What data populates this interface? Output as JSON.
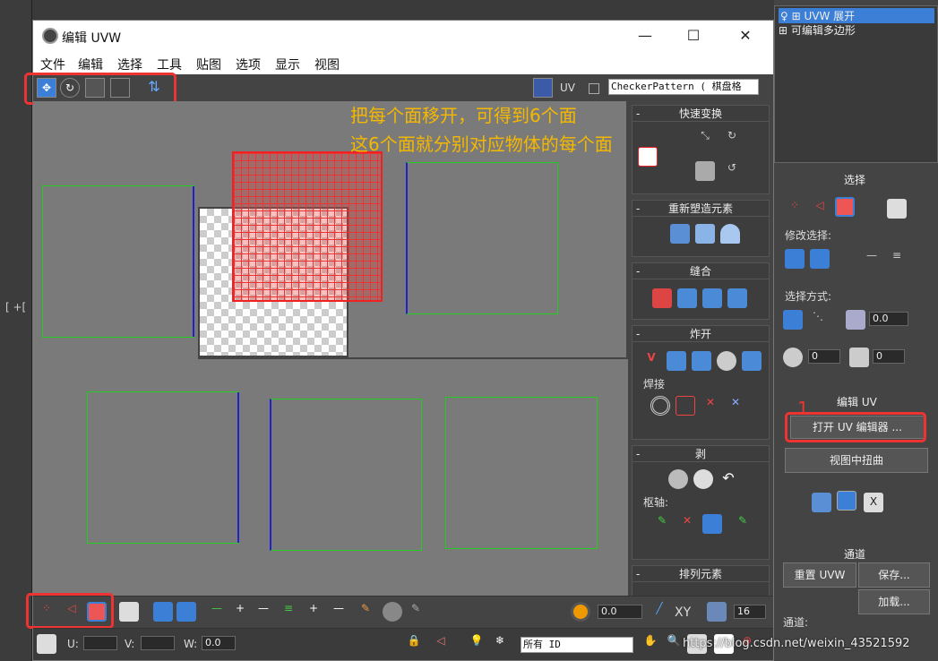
{
  "window": {
    "title": "编辑 UVW",
    "min": "—",
    "max": "☐",
    "close": "✕"
  },
  "menu": [
    "文件",
    "编辑",
    "选择",
    "工具",
    "贴图",
    "选项",
    "显示",
    "视图"
  ],
  "toolbar": {
    "uv_label": "UV",
    "texture_select": "CheckerPattern  ( 棋盘格"
  },
  "annotation": {
    "line1": "把每个面移开，可得到6个面",
    "line2": "这6个面就分别对应物体的每个面"
  },
  "right_panel": {
    "quick_transform": "快速变换",
    "reshape": "重新塑造元素",
    "stitch": "缝合",
    "explode": "炸开",
    "weld": "焊接",
    "peel": "剥",
    "pivot": "枢轴:",
    "arrange": "排列元素"
  },
  "bottom": {
    "spin_value": "0.0",
    "xy": "XY",
    "zoom_value": "16"
  },
  "status": {
    "u": "U:",
    "v": "V:",
    "w": "W:",
    "w_value": "0.0",
    "id_select": "所有 ID"
  },
  "modifier_stack": {
    "item1": "UVW 展开",
    "item2": "可编辑多边形"
  },
  "cmd": {
    "selection": "选择",
    "modify_selection": "修改选择:",
    "select_by": "选择方式:",
    "angle_value": "0.0",
    "num1": "0",
    "num2": "0",
    "edit_uv": "编辑 UV",
    "open_uv_editor": "打开 UV 编辑器 ...",
    "tweak_in_view": "视图中扭曲",
    "channel": "通道",
    "reset_uvw": "重置 UVW",
    "save": "保存...",
    "load": "加载...",
    "channel_label": "通道:",
    "step_number": "1"
  },
  "watermark": "https://blog.csdn.net/weixin_43521592",
  "viewport_label": "[ +[",
  "colors": {
    "highlight": "#e33333",
    "annotation": "#f5b800",
    "face_border": "#22cc22",
    "edge": "#2222cc"
  }
}
